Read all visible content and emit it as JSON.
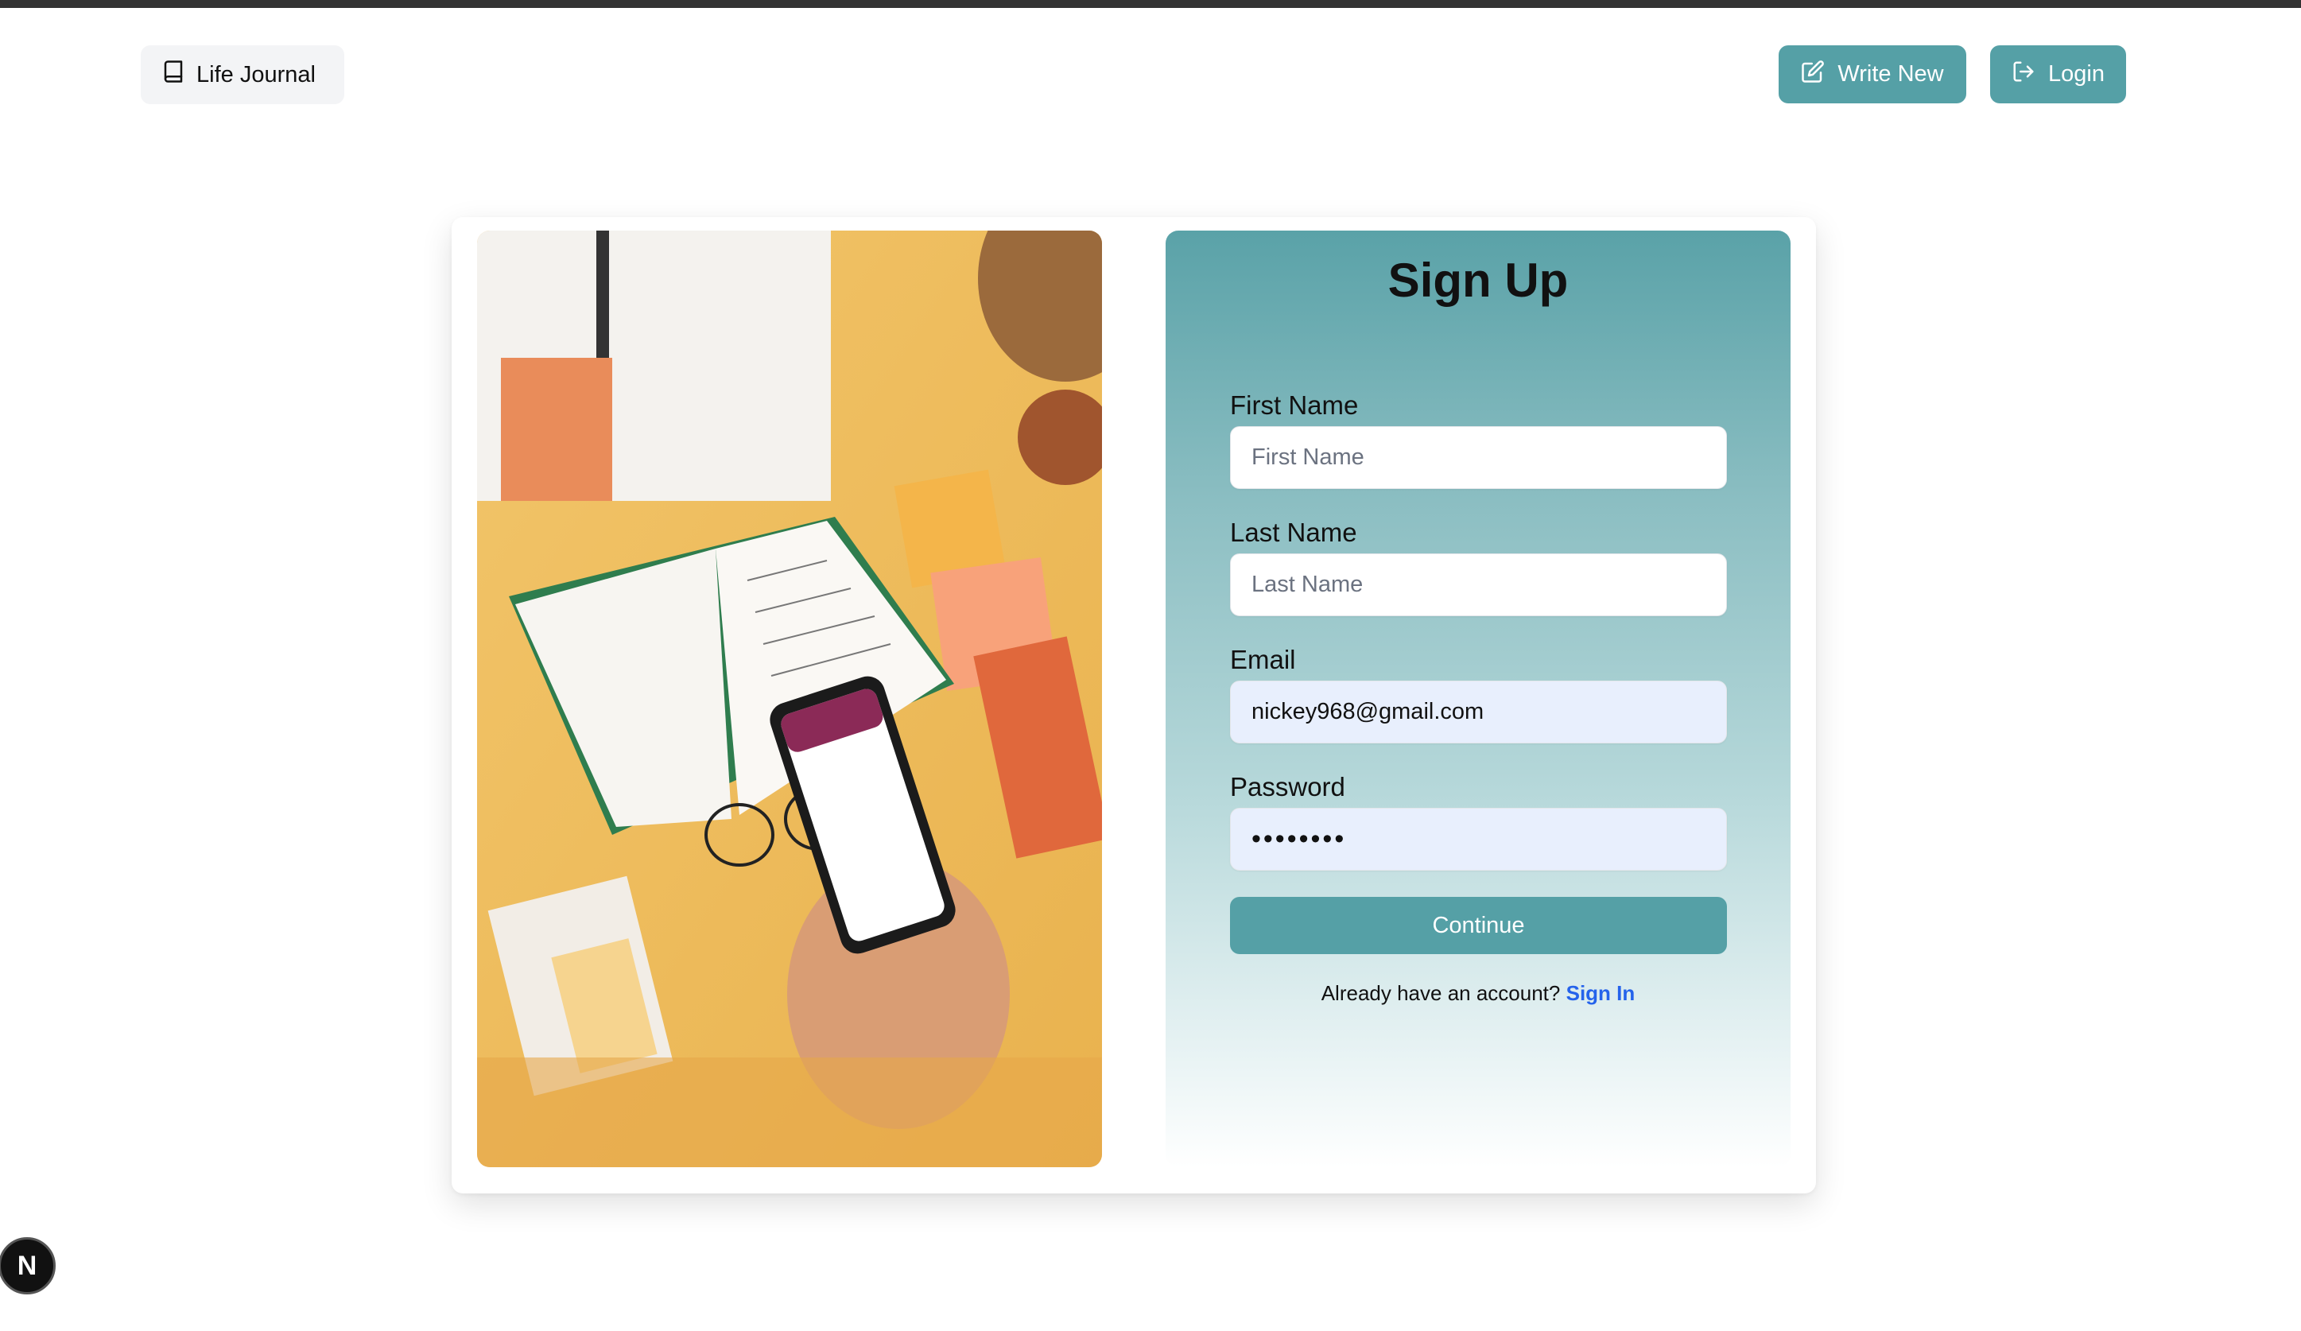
{
  "header": {
    "brand": "Life Journal",
    "write_new": "Write New",
    "login": "Login"
  },
  "form": {
    "title": "Sign Up",
    "first_name_label": "First Name",
    "first_name_placeholder": "First Name",
    "last_name_label": "Last Name",
    "last_name_placeholder": "Last Name",
    "email_label": "Email",
    "email_value": "nickey968@gmail.com",
    "password_label": "Password",
    "password_value": "password",
    "continue": "Continue",
    "footer_text": "Already have an account?",
    "sign_in": "Sign In"
  },
  "badge": {
    "letter": "N"
  },
  "colors": {
    "accent": "#55a0a6",
    "link": "#2563eb",
    "autofill": "#e8effd"
  },
  "icons": {
    "brand": "book-icon",
    "write": "pencil-square-icon",
    "login": "log-in-icon"
  }
}
